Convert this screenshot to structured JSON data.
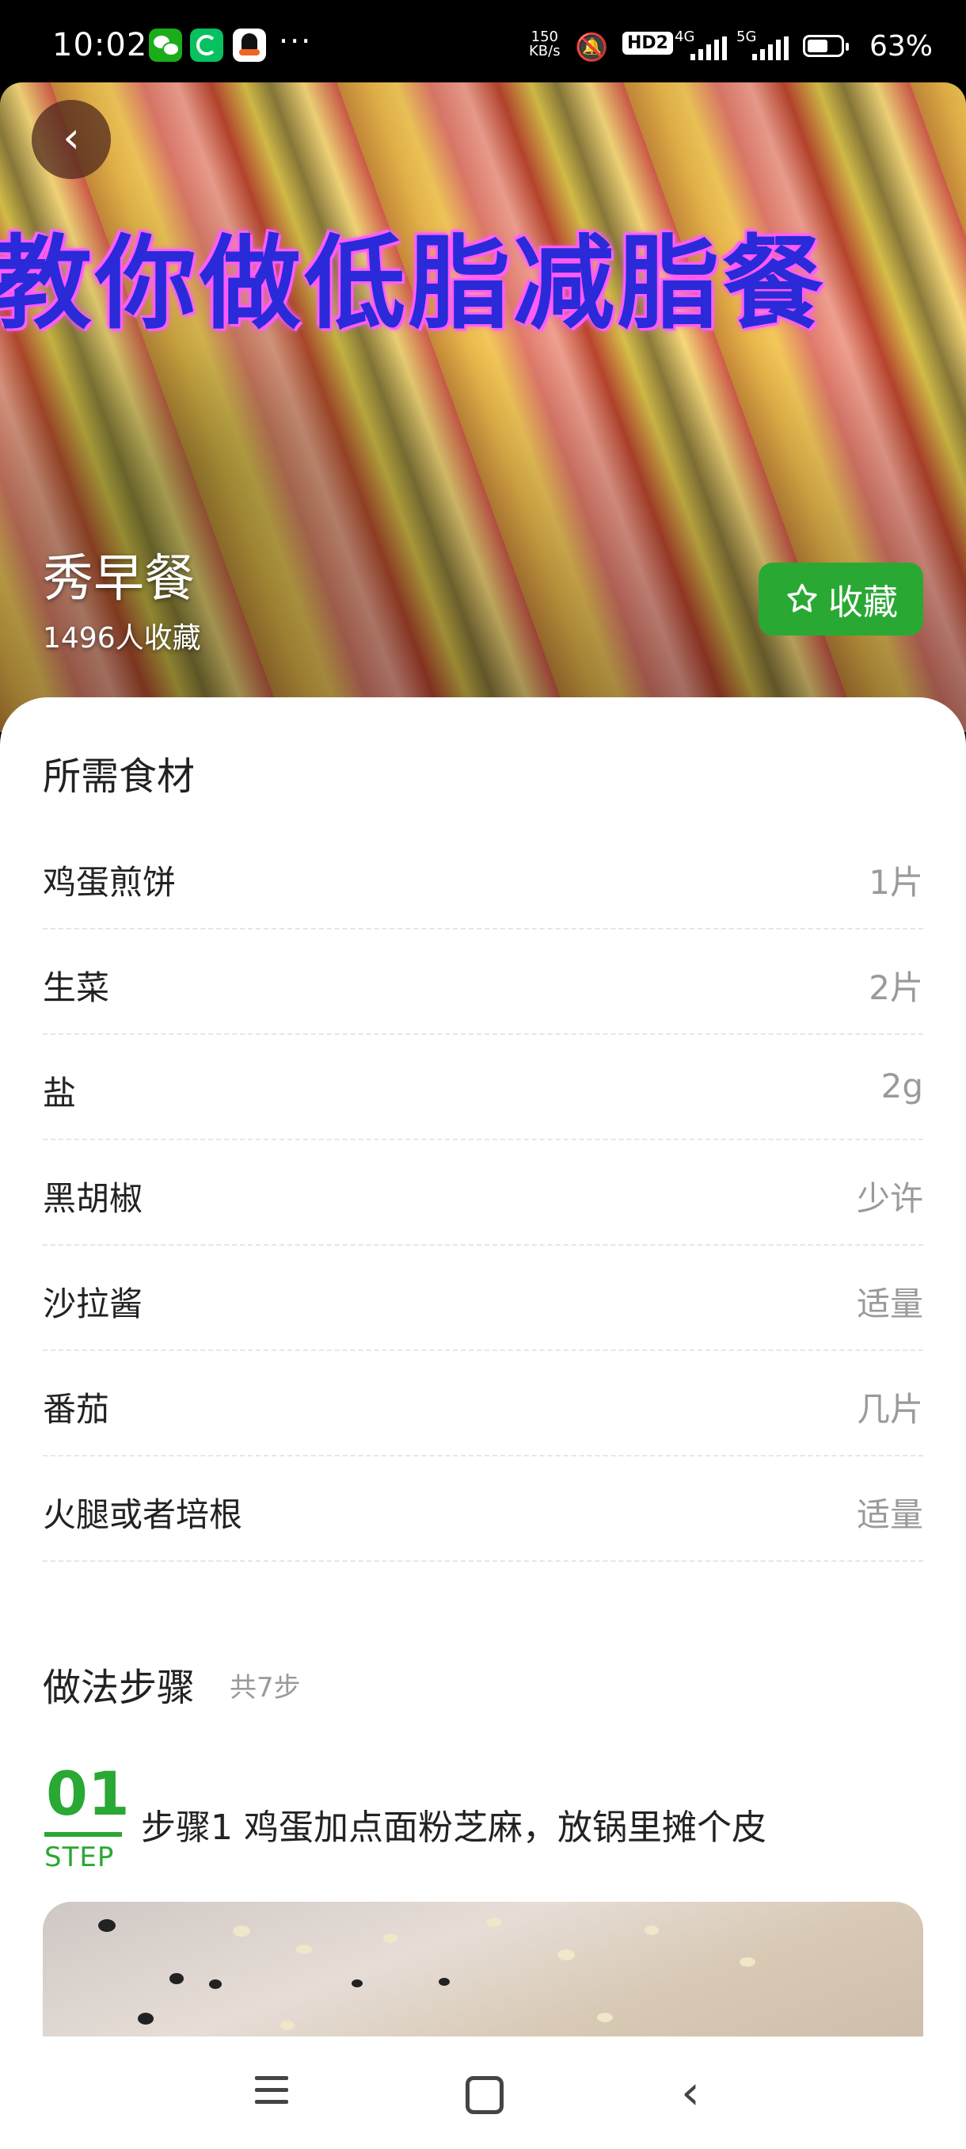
{
  "status_bar": {
    "time": "10:02",
    "more": "···",
    "speed_value": "150",
    "speed_unit": "KB/s",
    "hd": "HD2",
    "net1": "4G",
    "net2": "5G",
    "battery_percent": 63,
    "battery_text": "63%"
  },
  "hero": {
    "banner_text": "教你做低脂减脂餐",
    "title": "秀早餐",
    "favorites_count": "1496人收藏",
    "favorite_button_label": "收藏"
  },
  "ingredients": {
    "section_title": "所需食材",
    "items": [
      {
        "name": "鸡蛋煎饼",
        "qty": "1片"
      },
      {
        "name": "生菜",
        "qty": "2片"
      },
      {
        "name": "盐",
        "qty": "2g"
      },
      {
        "name": "黑胡椒",
        "qty": "少许"
      },
      {
        "name": "沙拉酱",
        "qty": "适量"
      },
      {
        "name": "番茄",
        "qty": "几片"
      },
      {
        "name": "火腿或者培根",
        "qty": "适量"
      }
    ]
  },
  "steps": {
    "section_title": "做法步骤",
    "count_label": "共7步",
    "first": {
      "number": "01",
      "step_word": "STEP",
      "text": "步骤1 鸡蛋加点面粉芝麻，放锅里摊个皮"
    }
  },
  "colors": {
    "accent_green": "#2aa834"
  }
}
